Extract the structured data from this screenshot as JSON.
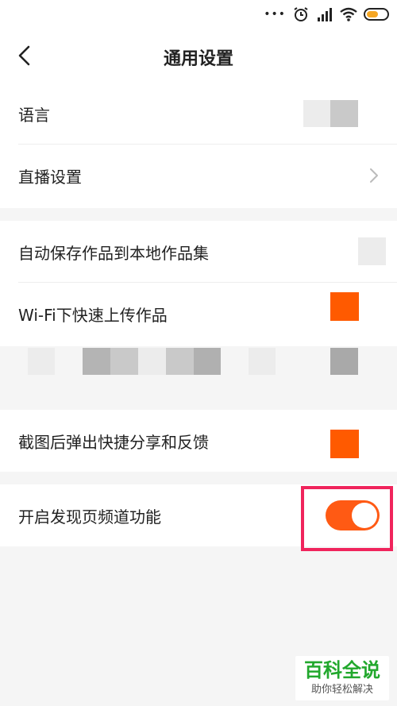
{
  "header": {
    "title": "通用设置"
  },
  "rows": {
    "language": "语言",
    "live_settings": "直播设置",
    "auto_save": "自动保存作品到本地作品集",
    "wifi_upload": "Wi-Fi下快速上传作品",
    "screenshot_share": "截图后弹出快捷分享和反馈",
    "discover_channel": "开启发现页频道功能"
  },
  "toggles": {
    "discover_channel_on": true
  },
  "colors": {
    "accent": "#ff5a14",
    "highlight": "#f0245c",
    "watermark_green": "#22a82d"
  },
  "icons": [
    "back-icon",
    "chevron-right-icon",
    "alarm-icon",
    "signal-icon",
    "wifi-icon",
    "battery-icon"
  ],
  "watermark": {
    "title": "百科全说",
    "subtitle": "助你轻松解决"
  }
}
